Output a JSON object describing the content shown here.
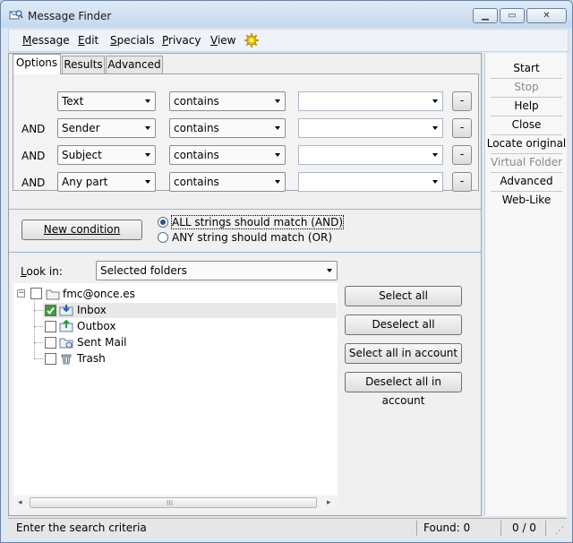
{
  "window": {
    "title": "Message Finder",
    "icon": "magnifier-mail-icon"
  },
  "menu": {
    "items": [
      {
        "label": "Message",
        "mnemonic": "M"
      },
      {
        "label": "Edit",
        "mnemonic": "E"
      },
      {
        "label": "Specials",
        "mnemonic": "S"
      },
      {
        "label": "Privacy",
        "mnemonic": "P"
      },
      {
        "label": "View",
        "mnemonic": "V"
      }
    ],
    "icon": "gear-sun-icon"
  },
  "tabs": [
    {
      "label": "Options",
      "active": true
    },
    {
      "label": "Results",
      "active": false
    },
    {
      "label": "Advanced",
      "active": false
    }
  ],
  "conditions": [
    {
      "joiner": "",
      "field": "Text",
      "operator": "contains",
      "value": ""
    },
    {
      "joiner": "AND",
      "field": "Sender",
      "operator": "contains",
      "value": ""
    },
    {
      "joiner": "AND",
      "field": "Subject",
      "operator": "contains",
      "value": ""
    },
    {
      "joiner": "AND",
      "field": "Any part",
      "operator": "contains",
      "value": ""
    }
  ],
  "remove_label": "-",
  "new_condition_label": "New condition",
  "match_options": [
    {
      "label": "ALL strings should match (AND)",
      "checked": true
    },
    {
      "label": "ANY string should match (OR)",
      "checked": false
    }
  ],
  "look_in": {
    "label": "Look in:",
    "selected": "Selected folders"
  },
  "tree": {
    "account": {
      "label": "fmc@once.es",
      "checked": false
    },
    "folders": [
      {
        "label": "Inbox",
        "checked": true,
        "icon": "inbox-icon"
      },
      {
        "label": "Outbox",
        "checked": false,
        "icon": "outbox-icon"
      },
      {
        "label": "Sent Mail",
        "checked": false,
        "icon": "sent-mail-icon"
      },
      {
        "label": "Trash",
        "checked": false,
        "icon": "trash-icon"
      }
    ]
  },
  "select_buttons": [
    "Select all",
    "Deselect all",
    "Select all in account",
    "Deselect all in account"
  ],
  "side_actions": [
    {
      "label": "Start",
      "enabled": true
    },
    {
      "label": "Stop",
      "enabled": false
    },
    {
      "label": "Help",
      "enabled": true
    },
    {
      "label": "Close",
      "enabled": true
    },
    {
      "label": "Locate original",
      "enabled": true
    },
    {
      "label": "Virtual Folder",
      "enabled": false
    },
    {
      "label": "Advanced",
      "enabled": true
    },
    {
      "label": "Web-Like",
      "enabled": true
    }
  ],
  "status": {
    "message": "Enter the search criteria",
    "found": "Found: 0",
    "position": "0 / 0"
  },
  "scroll_grip": "III"
}
